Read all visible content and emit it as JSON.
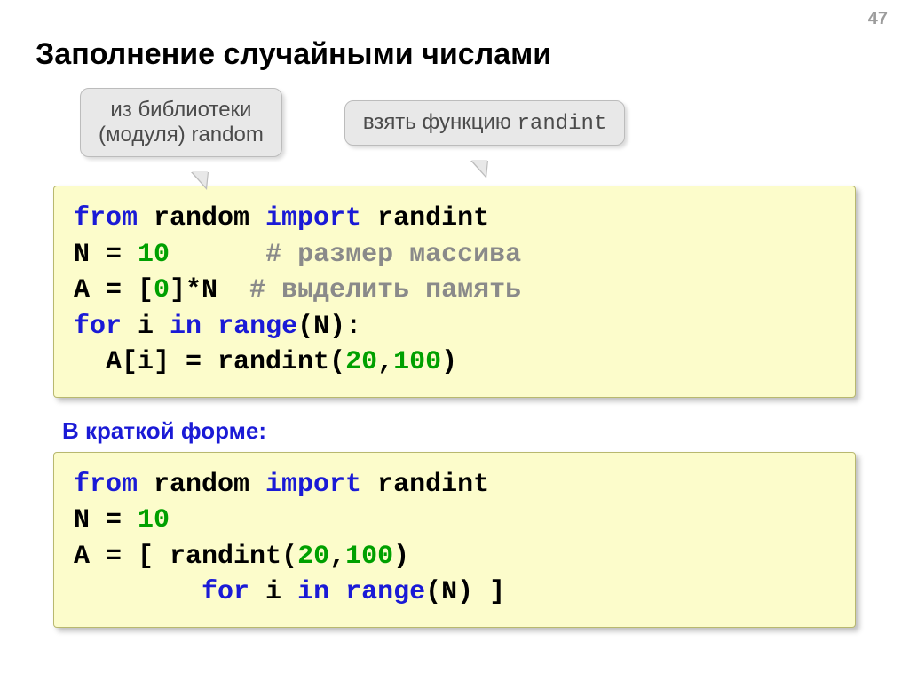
{
  "page_number": "47",
  "title": "Заполнение случайными числами",
  "callout_left_line1": "из библиотеки",
  "callout_left_line2": "(модуля) random",
  "callout_right_prefix": "взять функцию ",
  "callout_right_code": "randint",
  "code1": {
    "l1_kw1": "from",
    "l1_txt1": " random ",
    "l1_kw2": "import",
    "l1_txt2": " randint",
    "l2_txt1": "N = ",
    "l2_num": "10",
    "l2_sp": "      ",
    "l2_cm": "# размер массива",
    "l3_txt1": "A = [",
    "l3_num": "0",
    "l3_txt2": "]*N  ",
    "l3_cm": "# выделить память",
    "l4_kw1": "for",
    "l4_txt1": " i ",
    "l4_kw2": "in",
    "l4_txt2": " ",
    "l4_kw3": "range",
    "l4_txt3": "(N):",
    "l5_txt1": "  A[i] = ",
    "l5_fn": "randint(",
    "l5_n1": "20",
    "l5_c": ",",
    "l5_n2": "100",
    "l5_close": ")"
  },
  "subhead": "В краткой форме:",
  "code2": {
    "l1_kw1": "from",
    "l1_txt1": " random ",
    "l1_kw2": "import",
    "l1_txt2": " randint",
    "l2_txt1": "N = ",
    "l2_num": "10",
    "l3_txt1": "A = [ ",
    "l3_fn": "randint(",
    "l3_n1": "20",
    "l3_c": ",",
    "l3_n2": "100",
    "l3_close": ")",
    "l4_sp": "        ",
    "l4_kw1": "for",
    "l4_txt1": " i ",
    "l4_kw2": "in",
    "l4_txt2": " ",
    "l4_kw3": "range",
    "l4_txt3": "(N) ]"
  }
}
